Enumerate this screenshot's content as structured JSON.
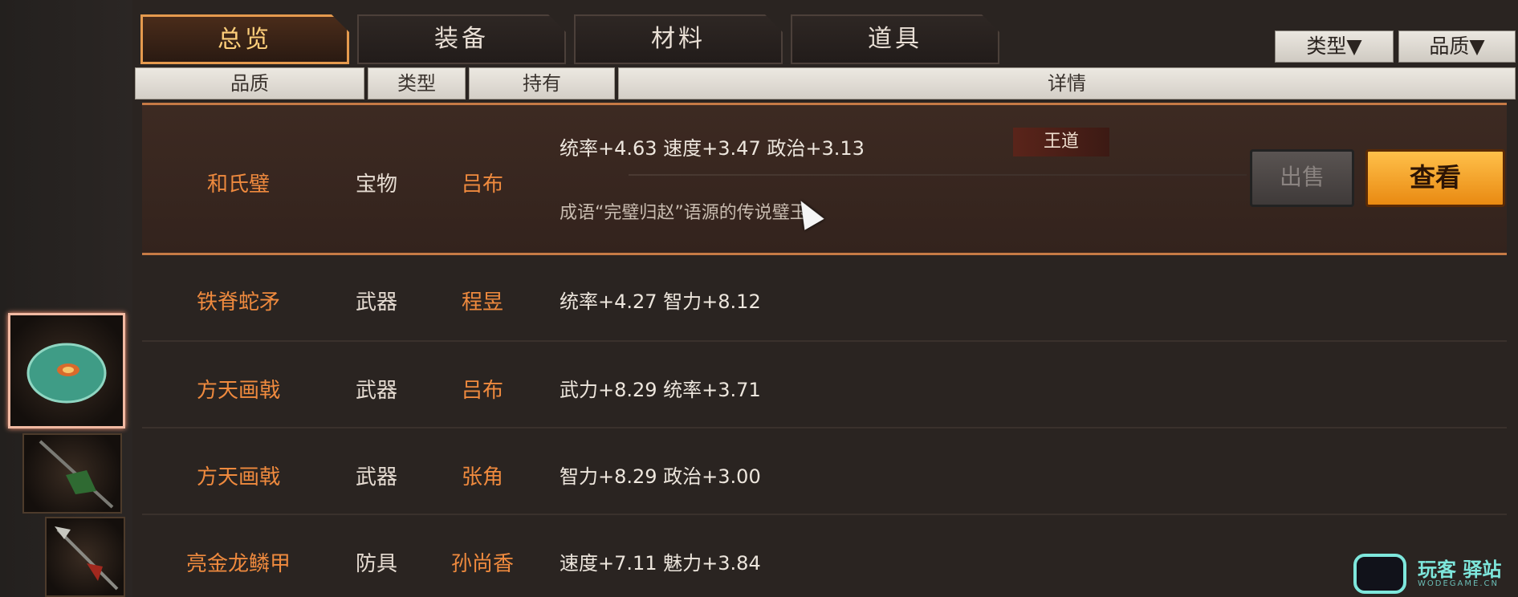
{
  "tabs": [
    {
      "label": "总览",
      "active": true
    },
    {
      "label": "装备",
      "active": false
    },
    {
      "label": "材料",
      "active": false
    },
    {
      "label": "道具",
      "active": false
    }
  ],
  "filters": {
    "type_label": "类型▼",
    "quality_label": "品质▼"
  },
  "columns": {
    "quality": "品质",
    "type": "类型",
    "owner": "持有",
    "detail": "详情"
  },
  "items": [
    {
      "name": "和氏璧",
      "type": "宝物",
      "owner": "吕布",
      "stats": "统率+4.63  速度+3.47  政治+3.13",
      "tag": "王道",
      "desc": "成语“完璧归赵”语源的传说璧玉"
    },
    {
      "name": "铁脊蛇矛",
      "type": "武器",
      "owner": "程昱",
      "stats": "统率+4.27  智力+8.12"
    },
    {
      "name": "方天画戟",
      "type": "武器",
      "owner": "吕布",
      "stats": "武力+8.29  统率+3.71"
    },
    {
      "name": "方天画戟",
      "type": "武器",
      "owner": "张角",
      "stats": "智力+8.29  政治+3.00"
    },
    {
      "name": "亮金龙鳞甲",
      "type": "防具",
      "owner": "孙尚香",
      "stats": "速度+7.11  魅力+3.84"
    }
  ],
  "actions": {
    "sell": "出售",
    "view": "查看"
  },
  "watermark": {
    "text": "玩客 驿站",
    "sub": "WODEGAME.CN"
  },
  "colors": {
    "accent": "#ef8a3e",
    "view_button": "#f5a623",
    "tag_bg": "#5a241a"
  }
}
